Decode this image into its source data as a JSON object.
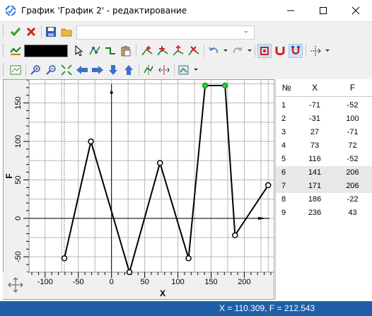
{
  "window": {
    "title": "График 'График 2' - редактирование",
    "controls": [
      "minimize",
      "maximize",
      "close"
    ]
  },
  "toolbar1": {
    "buttons": [
      "confirm-icon",
      "cancel-icon",
      "save-icon",
      "open-folder-icon"
    ],
    "combo_value": ""
  },
  "toolbar2": {
    "color": "#000000",
    "buttons": [
      "line-style-icon",
      "select-pointer-icon",
      "select-points-icon",
      "edit-path-icon",
      "paste-icon",
      "add-point-icon",
      "insert-point-icon",
      "move-point-icon",
      "delete-point-icon",
      "undo-icon",
      "redo-icon",
      "snap-grid-icon",
      "magnet-icon",
      "magnet-active-icon",
      "axes-settings-icon"
    ]
  },
  "toolbar3": {
    "buttons": [
      "fit-view-icon",
      "zoom-in-icon",
      "zoom-out-icon",
      "zoom-fit-icon",
      "arrow-left-icon",
      "arrow-right-icon",
      "arrow-down-icon",
      "arrow-up-icon",
      "vertical-align-icon",
      "horizontal-align-icon",
      "image-settings-icon"
    ]
  },
  "table": {
    "headers": [
      "№",
      "X",
      "F"
    ],
    "rows": [
      {
        "n": "1",
        "x": "-71",
        "f": "-52"
      },
      {
        "n": "2",
        "x": "-31",
        "f": "100"
      },
      {
        "n": "3",
        "x": "27",
        "f": "-71"
      },
      {
        "n": "4",
        "x": "73",
        "f": "72"
      },
      {
        "n": "5",
        "x": "116",
        "f": "-52"
      },
      {
        "n": "6",
        "x": "141",
        "f": "206"
      },
      {
        "n": "7",
        "x": "171",
        "f": "206"
      },
      {
        "n": "8",
        "x": "186",
        "f": "-22"
      },
      {
        "n": "9",
        "x": "236",
        "f": "43"
      }
    ],
    "selected_rows": [
      6,
      7
    ]
  },
  "status": {
    "text": "X = 110.309, F = 212.543"
  },
  "chart_data": {
    "type": "line",
    "xlabel": "X",
    "ylabel": "F",
    "xlim": [
      -120,
      240
    ],
    "ylim": [
      -70,
      180
    ],
    "x_ticks": [
      "-100",
      "-50",
      "0",
      "50",
      "100",
      "150",
      "200"
    ],
    "y_ticks": [
      "-50",
      "0",
      "50",
      "100",
      "150"
    ],
    "grid": true,
    "series": [
      {
        "x": [
          -71,
          -31,
          27,
          73,
          116,
          141,
          171,
          186,
          236
        ],
        "y": [
          -52,
          100,
          -71,
          72,
          -52,
          206,
          206,
          -22,
          43
        ]
      }
    ],
    "highlighted_points": [
      5,
      6
    ]
  }
}
